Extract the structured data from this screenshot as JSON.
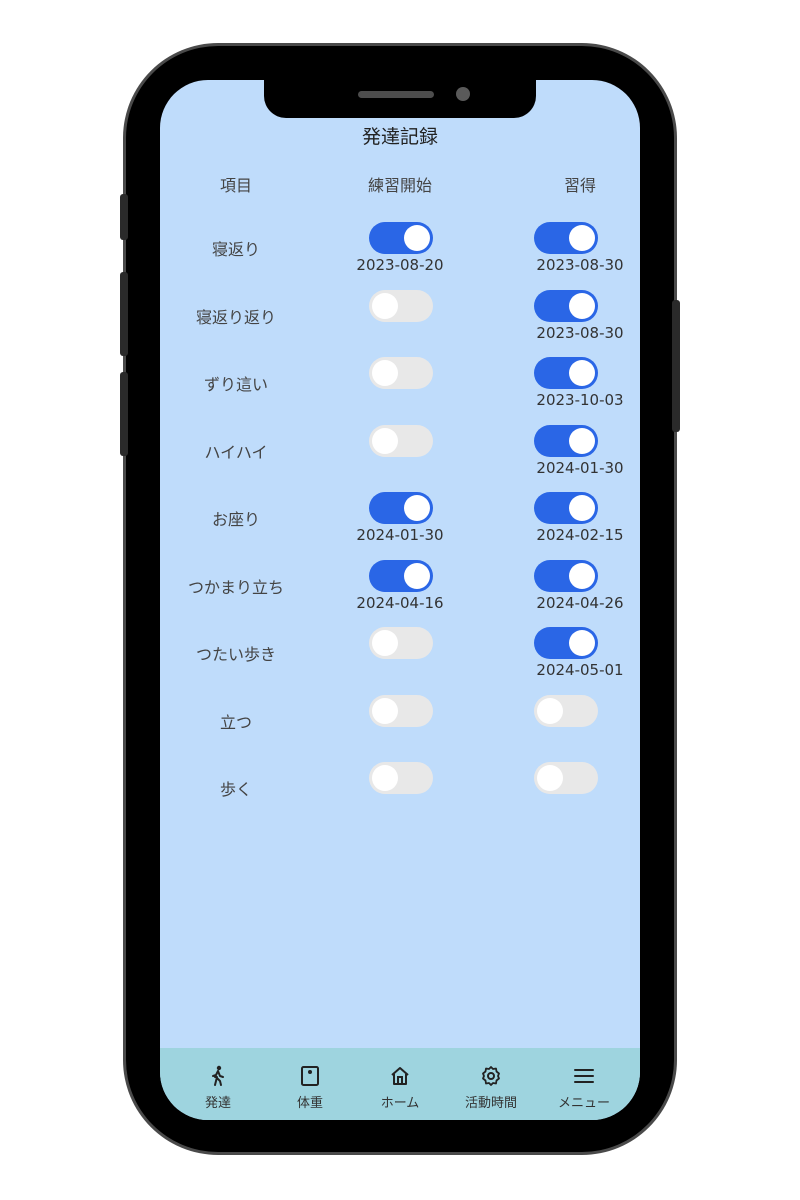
{
  "screen_title": "発達記録",
  "headers": {
    "item": "項目",
    "practice": "練習開始",
    "acquired": "習得"
  },
  "rows": [
    {
      "label": "寝返り",
      "practice_on": true,
      "practice_date": "2023-08-20",
      "acquired_on": true,
      "acquired_date": "2023-08-30"
    },
    {
      "label": "寝返り返り",
      "practice_on": false,
      "practice_date": "",
      "acquired_on": true,
      "acquired_date": "2023-08-30"
    },
    {
      "label": "ずり這い",
      "practice_on": false,
      "practice_date": "",
      "acquired_on": true,
      "acquired_date": "2023-10-03"
    },
    {
      "label": "ハイハイ",
      "practice_on": false,
      "practice_date": "",
      "acquired_on": true,
      "acquired_date": "2024-01-30"
    },
    {
      "label": "お座り",
      "practice_on": true,
      "practice_date": "2024-01-30",
      "acquired_on": true,
      "acquired_date": "2024-02-15"
    },
    {
      "label": "つかまり立ち",
      "practice_on": true,
      "practice_date": "2024-04-16",
      "acquired_on": true,
      "acquired_date": "2024-04-26"
    },
    {
      "label": "つたい歩き",
      "practice_on": false,
      "practice_date": "",
      "acquired_on": true,
      "acquired_date": "2024-05-01"
    },
    {
      "label": "立つ",
      "practice_on": false,
      "practice_date": "",
      "acquired_on": false,
      "acquired_date": ""
    },
    {
      "label": "歩く",
      "practice_on": false,
      "practice_date": "",
      "acquired_on": false,
      "acquired_date": ""
    }
  ],
  "nav": [
    {
      "label": "発達",
      "icon": "walking-person-icon"
    },
    {
      "label": "体重",
      "icon": "scale-icon"
    },
    {
      "label": "ホーム",
      "icon": "home-icon"
    },
    {
      "label": "活動時間",
      "icon": "gear-icon"
    },
    {
      "label": "メニュー",
      "icon": "menu-icon"
    }
  ],
  "colors": {
    "screen_bg": "#bfdcfb",
    "toggle_on": "#2a66e6",
    "toggle_off": "#e8e8e8",
    "nav_bg": "#9ed4df"
  }
}
